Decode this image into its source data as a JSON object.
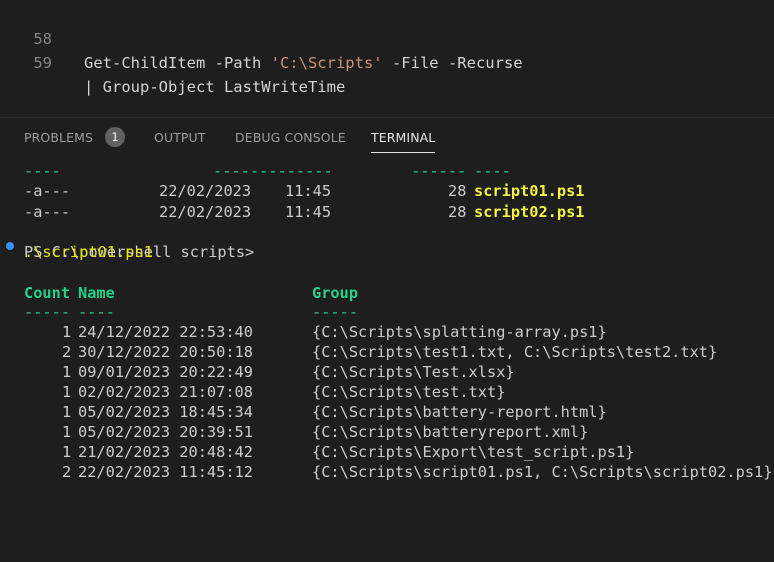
{
  "editor": {
    "lines": [
      {
        "number": "58",
        "pre": "Get-ChildItem -Path ",
        "string": "'C:\\Scripts'",
        "post": " -File -Recurse"
      },
      {
        "number": "59",
        "text": "| Group-Object LastWriteTime"
      }
    ]
  },
  "panel": {
    "tabs": [
      "PROBLEMS",
      "OUTPUT",
      "DEBUG CONSOLE",
      "TERMINAL"
    ],
    "problems_count": "1",
    "active_tab": "TERMINAL"
  },
  "terminal": {
    "sep_line": {
      "a": "----",
      "b": "-------------",
      "c": "------",
      "d": "----"
    },
    "files": [
      {
        "mode": "-a---",
        "date": "22/02/2023",
        "time": "11:45",
        "length": "28",
        "name": "script01.ps1"
      },
      {
        "mode": "-a---",
        "date": "22/02/2023",
        "time": "11:45",
        "length": "28",
        "name": "script02.ps1"
      }
    ],
    "prompt": "PS C:\\powershell scripts> ",
    "command": ".\\script01.ps1",
    "headers": {
      "count": "Count",
      "name": "Name",
      "group": "Group"
    },
    "header_seps": {
      "count": "-----",
      "name": "----",
      "group": "-----"
    },
    "rows": [
      {
        "count": "1",
        "name": "24/12/2022 22:53:40",
        "group": "{C:\\Scripts\\splatting-array.ps1}"
      },
      {
        "count": "2",
        "name": "30/12/2022 20:50:18",
        "group": "{C:\\Scripts\\test1.txt, C:\\Scripts\\test2.txt}"
      },
      {
        "count": "1",
        "name": "09/01/2023 20:22:49",
        "group": "{C:\\Scripts\\Test.xlsx}"
      },
      {
        "count": "1",
        "name": "02/02/2023 21:07:08",
        "group": "{C:\\Scripts\\test.txt}"
      },
      {
        "count": "1",
        "name": "05/02/2023 18:45:34",
        "group": "{C:\\Scripts\\battery-report.html}"
      },
      {
        "count": "1",
        "name": "05/02/2023 20:39:51",
        "group": "{C:\\Scripts\\batteryreport.xml}"
      },
      {
        "count": "1",
        "name": "21/02/2023 20:48:42",
        "group": "{C:\\Scripts\\Export\\test_script.ps1}"
      },
      {
        "count": "2",
        "name": "22/02/2023 11:45:12",
        "group": "{C:\\Scripts\\script01.ps1, C:\\Scripts\\script02.ps1}"
      }
    ]
  },
  "colors": {
    "background": "#1e1e1e",
    "header_green": "#23d18b",
    "file_yellow": "#f5f543",
    "command_yellow": "#e5e510",
    "string_orange": "#ce9178",
    "prompt_dot_blue": "#3794ff"
  }
}
